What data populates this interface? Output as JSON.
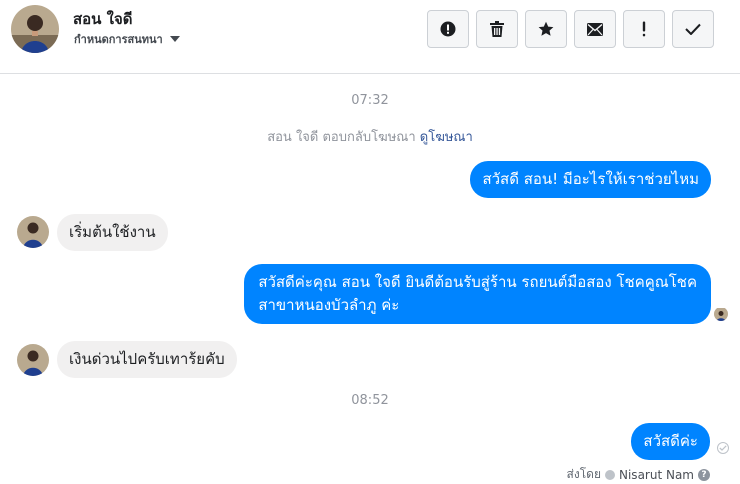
{
  "header": {
    "contact_name": "สอน ใจดี",
    "assign_label": "กำหนดการสนทนา",
    "toolbar": [
      {
        "icon": "alert-circle-icon"
      },
      {
        "icon": "trash-icon"
      },
      {
        "icon": "star-icon"
      },
      {
        "icon": "envelope-icon"
      },
      {
        "icon": "exclamation-icon"
      },
      {
        "icon": "check-icon"
      }
    ]
  },
  "conversation": {
    "timestamp_1": "07:32",
    "system_message": {
      "text": "สอน ใจดี ตอบกลับโฆษณา ",
      "link": "ดูโฆษณา"
    },
    "messages": [
      {
        "direction": "outgoing",
        "text": "สวัสดี สอน! มีอะไรให้เราช่วยไหม"
      },
      {
        "direction": "incoming",
        "text": "เริ่มต้นใช้งาน"
      },
      {
        "direction": "outgoing",
        "line1": "สวัสดีค่ะคุณ สอน ใจดี ยินดีต้อนรับสู่ร้าน รถยนต์มือสอง โชคคูณโชค",
        "line2": "สาขาหนองบัวลำภู ค่ะ"
      },
      {
        "direction": "incoming",
        "text": "เงินด่วนไปครับเทาร้ยคับ"
      },
      {
        "direction": "outgoing",
        "text": "สวัสดีค่ะ"
      }
    ],
    "timestamp_2": "08:52",
    "sent_by_prefix": "ส่งโดย",
    "sent_by_name": "Nisarut Nam"
  },
  "colors": {
    "outgoing_bubble": "#0084ff",
    "incoming_bubble": "#f1f0f0",
    "link": "#365899"
  }
}
